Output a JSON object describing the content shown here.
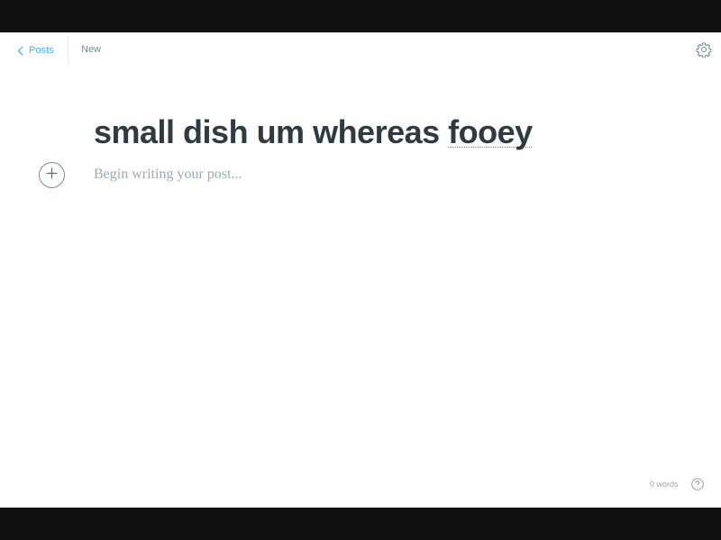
{
  "nav": {
    "back_label": "Posts",
    "status": "New",
    "settings_icon": "gear-icon",
    "back_icon": "chevron-left-icon"
  },
  "post": {
    "title_words": "small dish um whereas ",
    "title_flagged_word": "fooey",
    "body_placeholder": "Begin writing your post..."
  },
  "footer": {
    "word_count": "0 words",
    "help_icon": "help-circle-icon"
  },
  "colors": {
    "accent": "#3eb0ef",
    "title_text": "#303a41",
    "muted": "#738a94",
    "placeholder": "#99aab5",
    "spellcheck": "#e25440",
    "letterbox": "#111111"
  }
}
